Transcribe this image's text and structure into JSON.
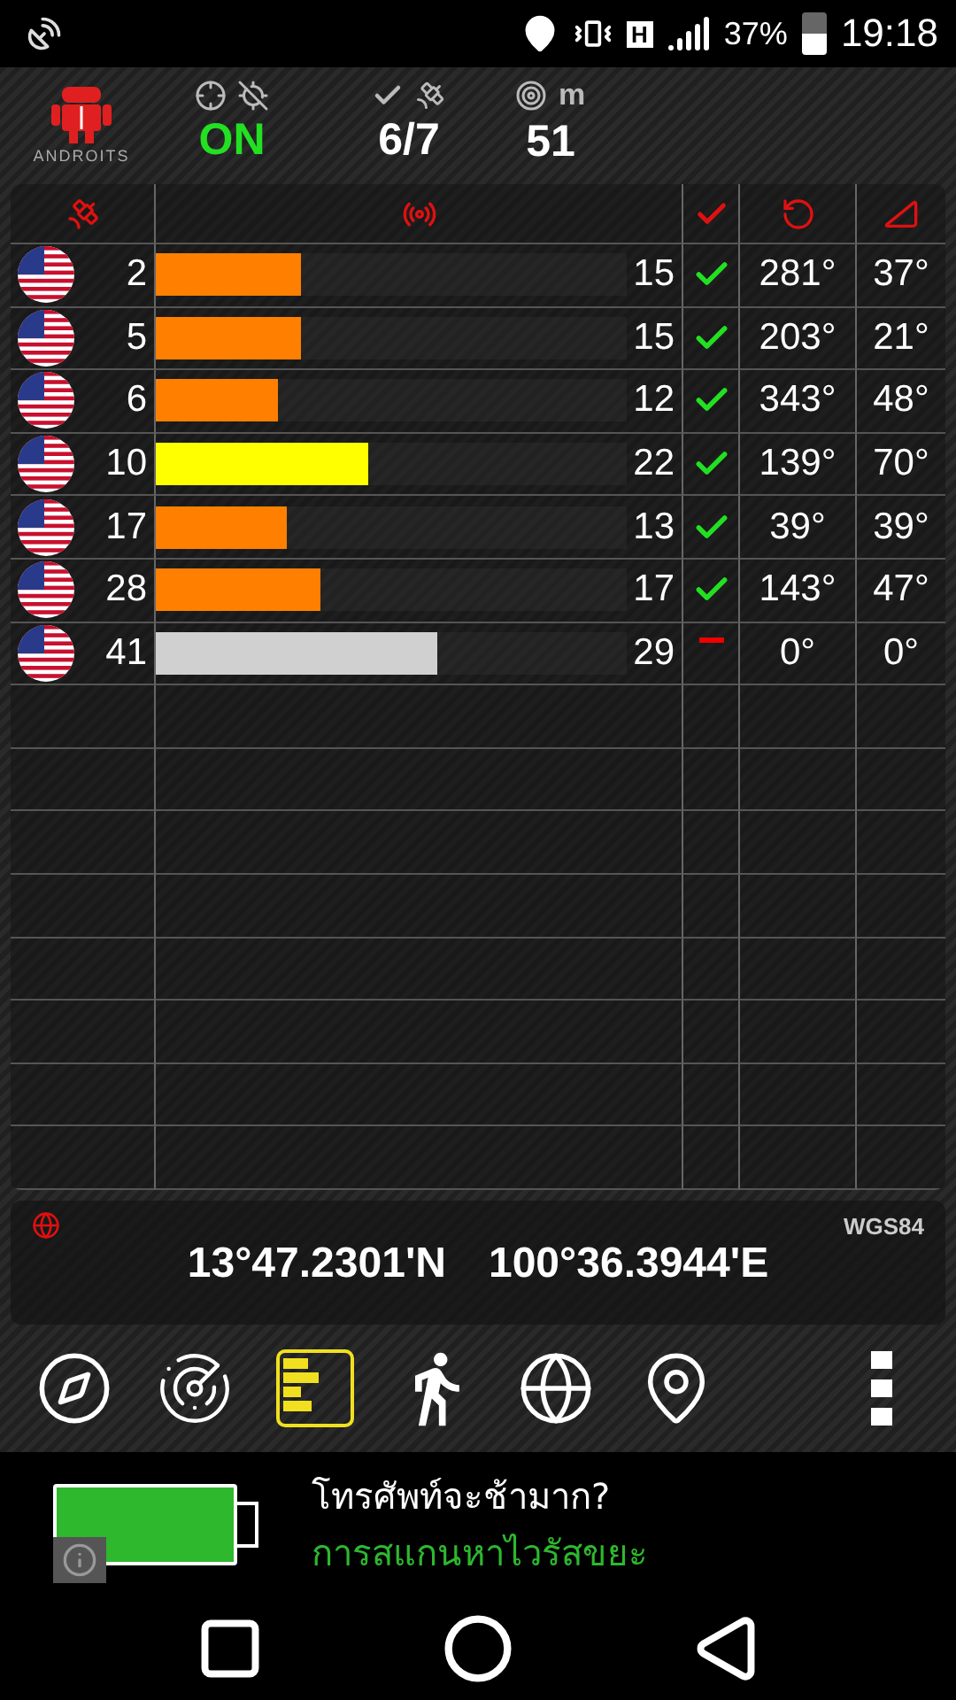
{
  "status_bar": {
    "network": "H",
    "battery": "37%",
    "time": "19:18"
  },
  "header": {
    "app": "ANDROITS",
    "fix": "ON",
    "used_visible": "6/7",
    "accuracy_unit": "m",
    "accuracy": "51"
  },
  "satellites": [
    {
      "prn": "2",
      "level": 0.31,
      "color": "#ff8000",
      "snr": "15",
      "used": true,
      "azimuth": "281°",
      "elevation": "37°"
    },
    {
      "prn": "5",
      "level": 0.31,
      "color": "#ff8000",
      "snr": "15",
      "used": true,
      "azimuth": "203°",
      "elevation": "21°"
    },
    {
      "prn": "6",
      "level": 0.26,
      "color": "#ff8000",
      "snr": "12",
      "used": true,
      "azimuth": "343°",
      "elevation": "48°"
    },
    {
      "prn": "10",
      "level": 0.45,
      "color": "#ffff00",
      "snr": "22",
      "used": true,
      "azimuth": "139°",
      "elevation": "70°"
    },
    {
      "prn": "17",
      "level": 0.28,
      "color": "#ff8000",
      "snr": "13",
      "used": true,
      "azimuth": "39°",
      "elevation": "39°"
    },
    {
      "prn": "28",
      "level": 0.35,
      "color": "#ff8000",
      "snr": "17",
      "used": true,
      "azimuth": "143°",
      "elevation": "47°"
    },
    {
      "prn": "41",
      "level": 0.6,
      "color": "#d0d0d0",
      "snr": "29",
      "used": false,
      "azimuth": "0°",
      "elevation": "0°"
    }
  ],
  "position": {
    "datum": "WGS84",
    "latitude": "13°47.2301'N",
    "longitude": "100°36.3944'E"
  },
  "toolbar": [
    {
      "kind": "compass",
      "selected": false
    },
    {
      "kind": "radar",
      "selected": false
    },
    {
      "kind": "bars",
      "selected": true
    },
    {
      "kind": "walk",
      "selected": false
    },
    {
      "kind": "globe",
      "selected": false
    },
    {
      "kind": "pin",
      "selected": false
    },
    {
      "kind": "more",
      "selected": false
    }
  ],
  "ad": {
    "title": "โทรศัพท์จะช้ามาก?",
    "subtitle": "การสแกนหาไวรัสขยะ"
  }
}
